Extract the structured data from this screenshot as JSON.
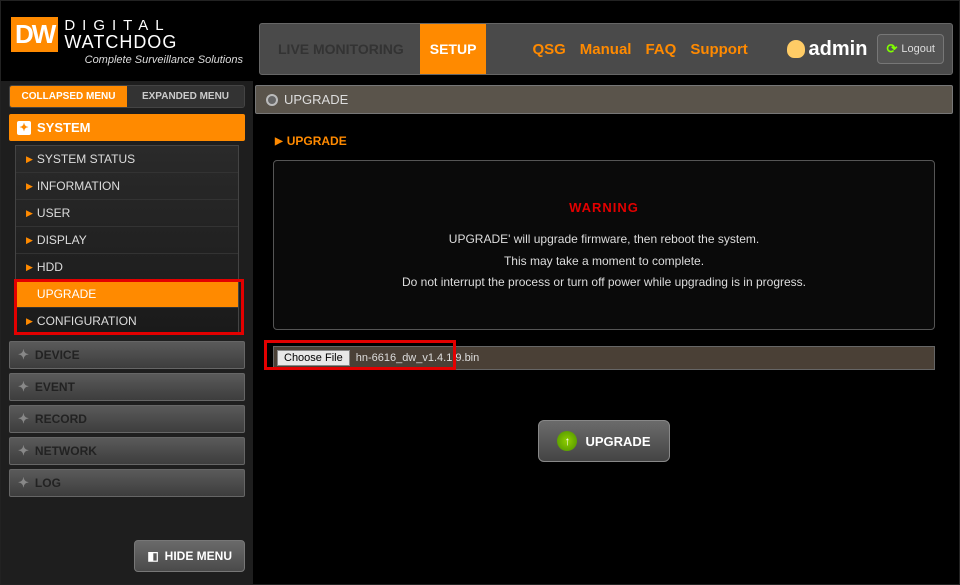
{
  "logo": {
    "abbrev": "DW",
    "line1": "DIGITAL",
    "line2": "WATCHDOG",
    "tagline": "Complete Surveillance Solutions"
  },
  "header": {
    "tabs": {
      "live": "LIVE MONITORING",
      "setup": "SETUP"
    },
    "links": {
      "qsg": "QSG",
      "manual": "Manual",
      "faq": "FAQ",
      "support": "Support"
    },
    "user": "admin",
    "logout": "Logout"
  },
  "sidebar": {
    "toggle": {
      "collapsed": "COLLAPSED MENU",
      "expanded": "EXPANDED MENU"
    },
    "system_label": "SYSTEM",
    "system_items": [
      "SYSTEM STATUS",
      "INFORMATION",
      "USER",
      "DISPLAY",
      "HDD",
      "UPGRADE",
      "CONFIGURATION"
    ],
    "groups": [
      "DEVICE",
      "EVENT",
      "RECORD",
      "NETWORK",
      "LOG"
    ],
    "hide": "HIDE MENU"
  },
  "main": {
    "breadcrumb": "UPGRADE",
    "section_title": "UPGRADE",
    "warning_label": "WARNING",
    "warn_line1": "UPGRADE' will upgrade firmware, then reboot the system.",
    "warn_line2": "This may take a moment to complete.",
    "warn_line3": "Do not interrupt the process or turn off power while upgrading is in progress.",
    "choose_file": "Choose File",
    "filename": "hn-6616_dw_v1.4.1.9.bin",
    "upgrade_btn": "UPGRADE"
  }
}
